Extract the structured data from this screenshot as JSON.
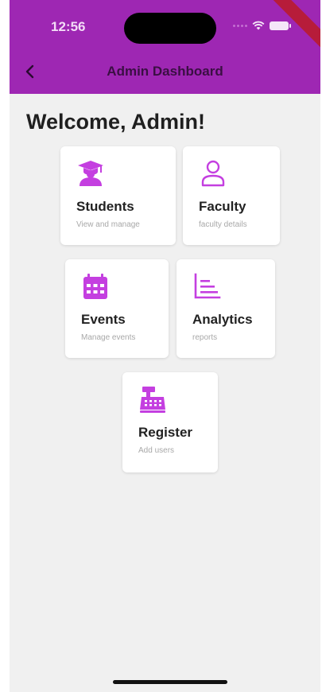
{
  "status_bar": {
    "time": "12:56"
  },
  "app_bar": {
    "title": "Admin Dashboard"
  },
  "welcome": "Welcome, Admin!",
  "cards": [
    {
      "title": "Students",
      "subtitle": "View and manage",
      "icon": "student-graduation-icon"
    },
    {
      "title": "Faculty",
      "subtitle": "faculty details",
      "icon": "person-icon"
    },
    {
      "title": "Events",
      "subtitle": "Manage events",
      "icon": "calendar-icon"
    },
    {
      "title": "Analytics",
      "subtitle": "reports",
      "icon": "analytics-chart-icon"
    },
    {
      "title": "Register",
      "subtitle": "Add users",
      "icon": "register-icon"
    }
  ],
  "colors": {
    "app_bar": "#9e27b3",
    "accent": "#c43fe0",
    "background": "#f0f0f0"
  }
}
